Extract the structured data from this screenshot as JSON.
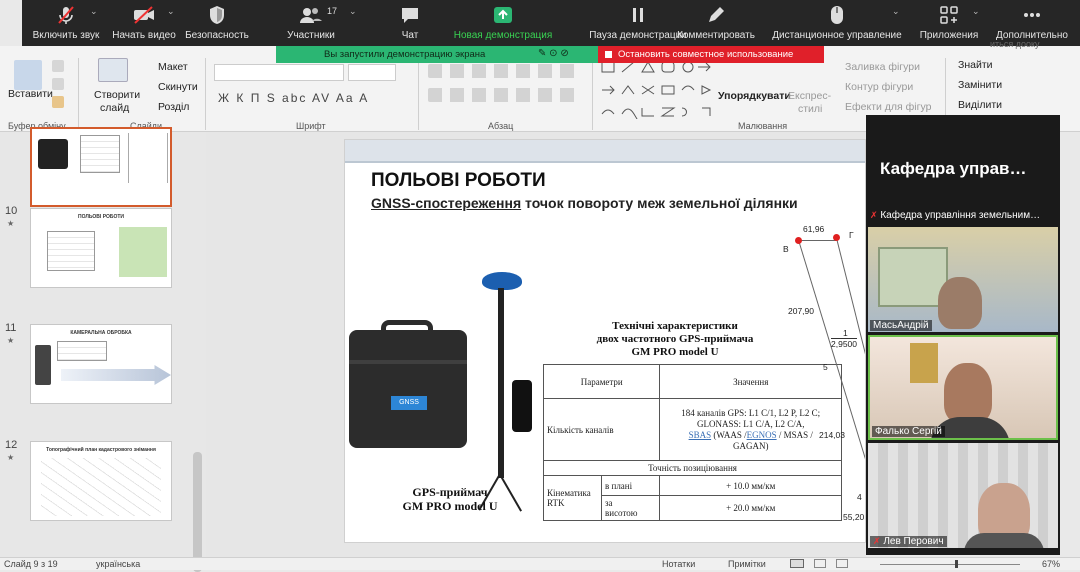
{
  "zoom": {
    "buttons": [
      {
        "label": "Включить звук",
        "icon": "mic-muted-icon"
      },
      {
        "label": "Начать видео",
        "icon": "video-off-icon"
      },
      {
        "label": "Безопасность",
        "icon": "shield-icon"
      },
      {
        "label": "Участники",
        "icon": "participants-icon",
        "count": "17"
      },
      {
        "label": "Чат",
        "icon": "chat-icon"
      },
      {
        "label": "Новая демонстрация",
        "icon": "share-screen-icon"
      },
      {
        "label": "Пауза демонстрации",
        "icon": "pause-icon"
      },
      {
        "label": "Комментировать",
        "icon": "pen-icon"
      },
      {
        "label": "Дистанционное управление",
        "icon": "mouse-icon"
      },
      {
        "label": "Приложения",
        "icon": "apps-icon"
      },
      {
        "label": "Дополнительно",
        "icon": "more-icon"
      }
    ],
    "share_msg": "Вы запустили демонстрацию экрана",
    "stop_share": "Остановить совместное использование",
    "green": "#2bb673",
    "red": "#e0202a"
  },
  "ribbon": {
    "paste": "Вставити",
    "clipboard": "Буфер обмінy",
    "new_slide_1": "Створити",
    "new_slide_2": "слайд",
    "layout": "Макет",
    "reset": "Скинути",
    "section": "Розділ",
    "slides_group": "Слайди",
    "font_group": "Шрифт",
    "font_tools": "Ж К П S abc AV Aa A",
    "paragraph_group": "Абзац",
    "arrange": "Упорядкувати",
    "quick_styles_1": "Експрес-",
    "quick_styles_2": "стилі",
    "shape_fill": "Заливка фігури",
    "shape_outline": "Контур фігури",
    "shape_effects": "Ефекти для фігур",
    "drawing_group": "Малювання",
    "find": "Знайти",
    "replace": "Замінити",
    "select": "Виділити",
    "edge_text": "иться дооку"
  },
  "thumbs": [
    {
      "num": "",
      "title": ""
    },
    {
      "num": "10",
      "title": "ПОЛЬОВІ РОБОТИ"
    },
    {
      "num": "11",
      "title": "КАМЕРАЛЬНА ОБРОБКА"
    },
    {
      "num": "12",
      "title": "Топографічний план кадастрового знімання"
    }
  ],
  "slide": {
    "title": "ПОЛЬОВІ РОБОТИ",
    "subtitle_underlined": "GNSS-спостереження",
    "subtitle_rest": " точок повороту меж земельної ділянки",
    "case_label": "GNSS",
    "spec_heading_1": "Технічні характеристики",
    "spec_heading_2": "двох частотного GPS-приймача",
    "spec_heading_3": "GM PRO model U",
    "table": {
      "h_param": "Параметри",
      "h_value": "Значення",
      "channels_label": "Кількість каналів",
      "channels_value_1": "184 каналів GPS: L1 C/1, L2 P, L2 C;",
      "channels_value_2": "GLONASS: L1 C/A, L2 C/A,",
      "channels_sbas": "SBAS",
      "channels_value_3": " (WAAS /",
      "channels_egnos": "EGNOS",
      "channels_value_4": " / MSAS /",
      "channels_value_5": "GAGAN)",
      "accuracy": "Точність позиціювання",
      "kinematics_1": "Кінематика",
      "kinematics_2": "RTK",
      "plan": "в плані",
      "plan_value": "+ 10.0 мм/км",
      "height_1": "за",
      "height_2": "висотою",
      "height_value": "+ 20.0 мм/км"
    },
    "caption_1": "GPS-приймач",
    "caption_2": "GM PRO model U",
    "plot": {
      "d1": "61,96",
      "d2": "207,90",
      "d3": "1",
      "d4": "2,9500",
      "d5": "5",
      "d6": "214,03",
      "d7": "4",
      "d8": "55,20",
      "pB": "В",
      "pG": "Г"
    }
  },
  "video": {
    "title": "Кафедра управ…",
    "host": "Кафедра управління земельним…",
    "p1": "МасьАндрій",
    "p2": "Фалько Сергій",
    "p3": "Лев Перович"
  },
  "status": {
    "slide": "Слайд 9 з 19",
    "lang": "українська",
    "notes": "Нотатки",
    "comments": "Примітки",
    "zoom": "67%"
  }
}
